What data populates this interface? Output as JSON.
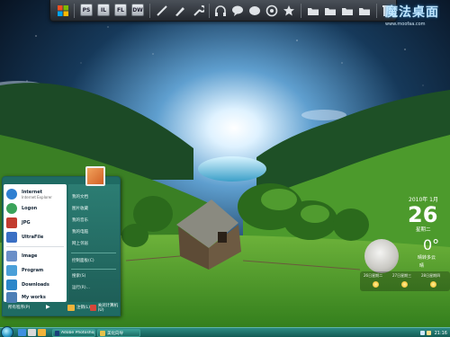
{
  "start_menu": {
    "left_items": [
      {
        "label": "Internet",
        "sub": "Internet Explorer",
        "icon": "internet-explorer-icon",
        "color": "#2f7fd1"
      },
      {
        "label": "Logon",
        "sub": "",
        "icon": "logon-icon",
        "color": "#3aa35a"
      },
      {
        "label": "JPG",
        "sub": "",
        "icon": "jpg-icon",
        "color": "#c23b2e"
      },
      {
        "label": "UltraFile",
        "sub": "",
        "icon": "ultrafile-icon",
        "color": "#3a6fc4"
      },
      {
        "label": "Image",
        "sub": "",
        "icon": "image-icon",
        "color": "#6b8fc8"
      },
      {
        "label": "Program",
        "sub": "",
        "icon": "program-icon",
        "color": "#4a9fd8"
      },
      {
        "label": "Downloads",
        "sub": "",
        "icon": "downloads-icon",
        "color": "#2b86c9"
      },
      {
        "label": "My works",
        "sub": "",
        "icon": "my-works-icon",
        "color": "#4d7fb6"
      }
    ],
    "right_items": [
      "我的文档",
      "图片收藏",
      "我的音乐",
      "我的电脑",
      "网上邻居",
      "控制面板(C)",
      "搜索(S)",
      "运行(R)..."
    ],
    "all_programs": "所有程序(P)",
    "logoff": "注销(L)",
    "shutdown": "关闭计算机(U)"
  },
  "taskbar": {
    "windows": [
      {
        "label": "Adobe Photoshop ...",
        "icon": "photoshop-icon"
      },
      {
        "label": "美化向导",
        "icon": "wizard-icon"
      }
    ],
    "clock": "21:16"
  },
  "gadget": {
    "date": "2010年 1月",
    "day": "26",
    "weekday": "星期二",
    "temp": "0°",
    "city": "晴转多云",
    "condition": "晴",
    "forecast": [
      "26日星期二",
      "27日星期三",
      "28日星期四"
    ]
  },
  "watermark": {
    "title": "魔法桌面",
    "url": "www.moofaa.com"
  },
  "dock_icons": [
    "windows-logo-icon",
    "photoshop-icon",
    "illustrator-icon",
    "flash-icon",
    "dreamweaver-icon",
    "brush-icon",
    "pen-icon",
    "wrench-icon",
    "headphones-icon",
    "chat-bubble-icon",
    "contact-icon",
    "browser-icon",
    "star-icon",
    "folder-icon",
    "folder-icon",
    "folder-icon",
    "folder-icon",
    "trash-icon"
  ],
  "dock_labels": {
    "ps": "PS",
    "ai": "IL",
    "fl": "FL",
    "dw": "DW"
  }
}
